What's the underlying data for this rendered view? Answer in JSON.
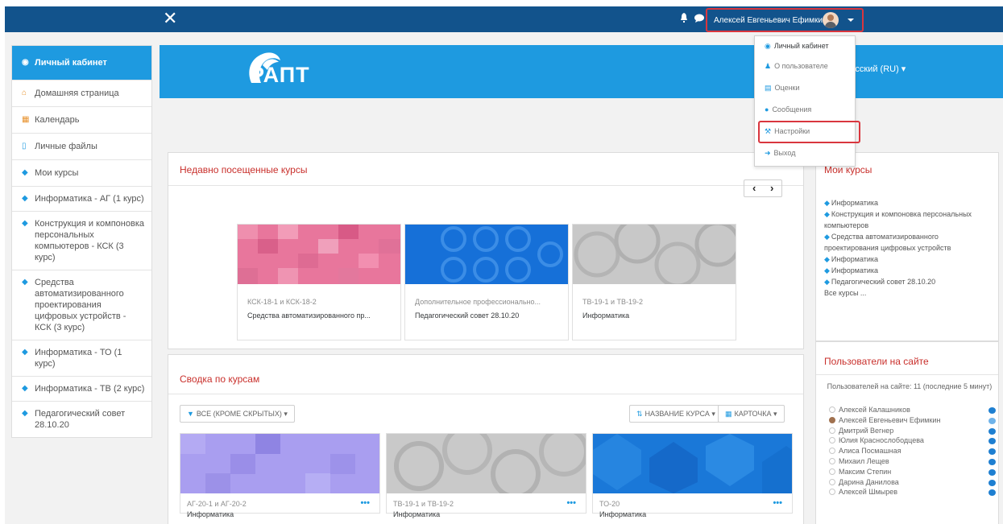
{
  "navbar": {
    "close_glyph": "✕",
    "user_name": "Алексей Евгеньевич Ефимкин",
    "icons": [
      "bell-icon",
      "chat-icon"
    ]
  },
  "banner": {
    "logo_text": "РАПТ",
    "language": "усский (RU) ▾"
  },
  "sidebar": {
    "items": [
      {
        "label": "Личный кабинет",
        "icon": "dashboard-icon"
      },
      {
        "label": "Домашняя страница",
        "icon": "home-icon"
      },
      {
        "label": "Календарь",
        "icon": "calendar-icon"
      },
      {
        "label": "Личные файлы",
        "icon": "file-icon"
      },
      {
        "label": "Мои курсы",
        "icon": "graduation-cap-icon"
      },
      {
        "label": "Информатика - АГ (1 курс)",
        "icon": "graduation-cap-icon"
      },
      {
        "label": "Конструкция и компоновка персональных компьютеров - КСК (3 курс)",
        "icon": "graduation-cap-icon"
      },
      {
        "label": "Средства автоматизированного проектирования цифровых устройств - КСК (3 курс)",
        "icon": "graduation-cap-icon"
      },
      {
        "label": "Информатика - ТО (1 курс)",
        "icon": "graduation-cap-icon"
      },
      {
        "label": "Информатика - ТВ (2 курс)",
        "icon": "graduation-cap-icon"
      },
      {
        "label": "Педагогический совет 28.10.20",
        "icon": "graduation-cap-icon"
      }
    ]
  },
  "user_menu": {
    "items": [
      {
        "label": "Личный кабинет",
        "icon": "dashboard-icon"
      },
      {
        "label": "О пользователе",
        "icon": "user-icon"
      },
      {
        "label": "Оценки",
        "icon": "grades-icon"
      },
      {
        "label": "Сообщения",
        "icon": "chat-icon"
      },
      {
        "label": "Настройки",
        "icon": "wrench-icon"
      },
      {
        "label": "Выход",
        "icon": "logout-icon"
      }
    ]
  },
  "recent": {
    "title": "Недавно посещенные курсы",
    "courses": [
      {
        "category": "КСК-18-1 и КСК-18-2",
        "name": "Средства автоматизированного пр..."
      },
      {
        "category": "Дополнительное профессионально...",
        "name": "Педагогический совет 28.10.20"
      },
      {
        "category": "ТВ-19-1 и ТВ-19-2",
        "name": "Информатика"
      }
    ]
  },
  "overview": {
    "title": "Сводка по курсам",
    "filter": "ВСЕ (КРОМЕ СКРЫТЫХ) ▾",
    "sort": "НАЗВАНИЕ КУРСА ▾",
    "view": "КАРТОЧКА ▾",
    "courses": [
      {
        "category": "АГ-20-1 и АГ-20-2",
        "name": "Информатика"
      },
      {
        "category": "ТВ-19-1 и ТВ-19-2",
        "name": "Информатика"
      },
      {
        "category": "ТО-20",
        "name": "Информатика"
      }
    ]
  },
  "my_courses": {
    "title": "Мои курсы",
    "items": [
      "Информатика",
      "Конструкция и компоновка персональных компьютеров",
      "Средства автоматизированного проектирования цифровых устройств",
      "Информатика",
      "Информатика",
      "Педагогический совет 28.10.20"
    ],
    "all_link": "Все курсы ..."
  },
  "online": {
    "title": "Пользователи на сайте",
    "summary": "Пользователей на сайте: 11 (последние 5 минут)",
    "users": [
      "Алексей Калашников",
      "Алексей Евгеньевич Ефимкин",
      "Дмитрий Вегнер",
      "Юлия Краснослободцева",
      "Алиса Посмашная",
      "Михаил Лещев",
      "Максим Степин",
      "Дарина Данилова",
      "Алексей Шмырев"
    ]
  },
  "colors": {
    "navbar": "#12538c",
    "brand_blue": "#1e9ae0",
    "title_red": "#c9302c",
    "highlight_red": "#d9363e"
  }
}
